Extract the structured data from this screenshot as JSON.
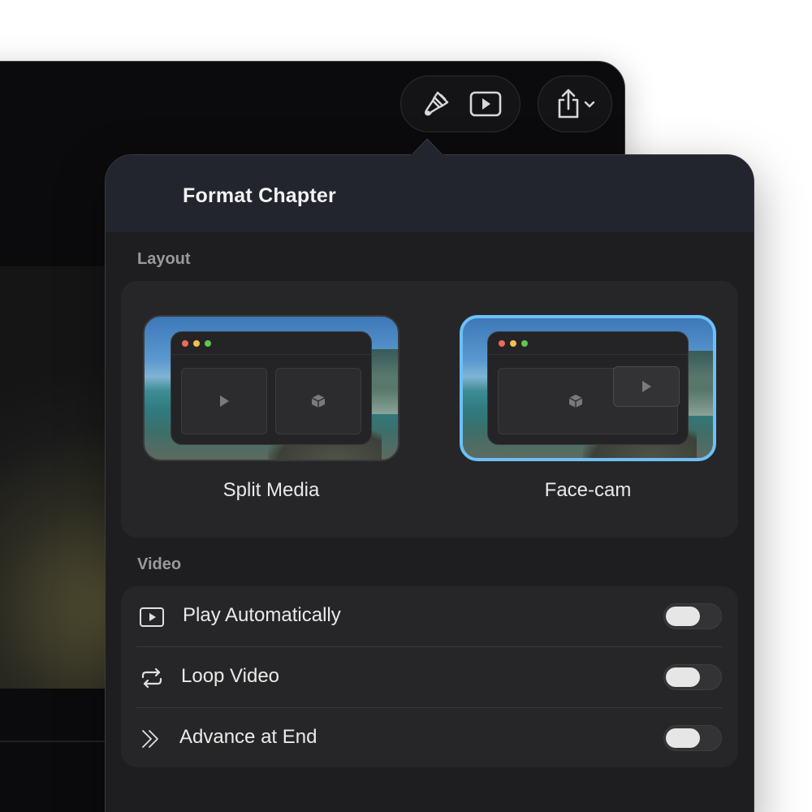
{
  "popover": {
    "title": "Format Chapter"
  },
  "layout": {
    "section_label": "Layout",
    "options": [
      {
        "label": "Split Media",
        "selected": false
      },
      {
        "label": "Face-cam",
        "selected": true
      }
    ]
  },
  "video": {
    "section_label": "Video",
    "rows": [
      {
        "label": "Play Automatically",
        "icon": "play-rectangle-icon",
        "enabled": false
      },
      {
        "label": "Loop Video",
        "icon": "loop-arrows-icon",
        "enabled": false
      },
      {
        "label": "Advance at End",
        "icon": "double-chevron-right-icon",
        "enabled": false
      }
    ]
  },
  "colors": {
    "accent_selected": "#6cc0f7",
    "window_dot_red": "#ec6a5e",
    "window_dot_yellow": "#f4bf4f",
    "window_dot_green": "#61c554"
  }
}
